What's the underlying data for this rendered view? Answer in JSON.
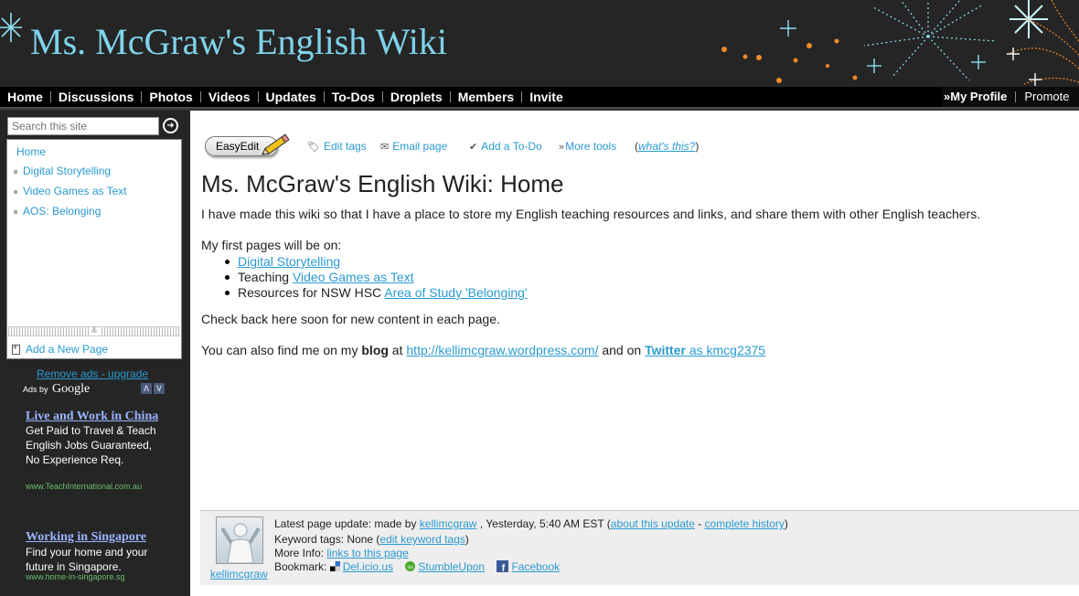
{
  "site": {
    "title": "Ms. McGraw's English Wiki"
  },
  "nav": {
    "items": [
      "Home",
      "Discussions",
      "Photos",
      "Videos",
      "Updates",
      "To-Dos",
      "Droplets",
      "Members",
      "Invite"
    ],
    "my_profile": "My Profile",
    "promote": "Promote"
  },
  "sidebar": {
    "search_placeholder": "Search this site",
    "home": "Home",
    "pages": [
      "Digital Storytelling",
      "Video Games as Text",
      "AOS: Belonging"
    ],
    "add_page": "Add a New Page",
    "remove_ads": "Remove ads - upgrade",
    "ads_by": "Ads by",
    "google": "Google",
    "ads": [
      {
        "title": "Live and Work in China",
        "body": "Get Paid to Travel & Teach English Jobs Guaranteed, No Experience Req.",
        "url": "www.TeachInternational.com.au"
      },
      {
        "title": "Working in Singapore",
        "body": "Find your home and your future in Singapore.",
        "url": "www.home-in-singapore.sg"
      }
    ]
  },
  "toolbar": {
    "easyedit": "EasyEdit",
    "edit_tags": "Edit tags",
    "email_page": "Email page",
    "add_todo": "Add a To-Do",
    "more_tools": "More tools",
    "whats_this": "what's this?"
  },
  "page": {
    "title": "Ms. McGraw's English Wiki: Home",
    "intro": "I have made this wiki so that I have a place to store my English teaching resources and links, and share them with other English teachers.",
    "first_pages_label": "My first pages will be on:",
    "list": [
      {
        "prefix": "",
        "link": "Digital Storytelling"
      },
      {
        "prefix": "Teaching ",
        "link": "Video Games as Text"
      },
      {
        "prefix": "Resources for NSW HSC ",
        "link": "Area of Study 'Belonging'"
      }
    ],
    "check_back": "Check back here soon for new content in each page.",
    "find_me_prefix": "You can also find me on my ",
    "blog_word": "blog",
    "at": " at ",
    "blog_url": "http://kellimcgraw.wordpress.com/",
    "and_on": " and on ",
    "twitter_word": "Twitter",
    "twitter_handle": " as kmcg2375"
  },
  "footer": {
    "avatar_user": "kellimcgraw",
    "latest_label": "Latest page update: made by ",
    "latest_user": "kellimcgraw",
    "latest_time": " , Yesterday, 5:40 AM EST (",
    "about_update": "about this update",
    "dash": " - ",
    "complete_history": "complete history",
    "close_paren": ")",
    "keyword_label": "Keyword tags: None (",
    "edit_keyword_tags": "edit keyword tags",
    "more_info_label": "More Info: ",
    "links_to_page": "links to this page",
    "bookmark_label": "Bookmark: ",
    "delicious": "Del.icio.us",
    "stumbleupon": "StumbleUpon",
    "facebook": "Facebook"
  }
}
